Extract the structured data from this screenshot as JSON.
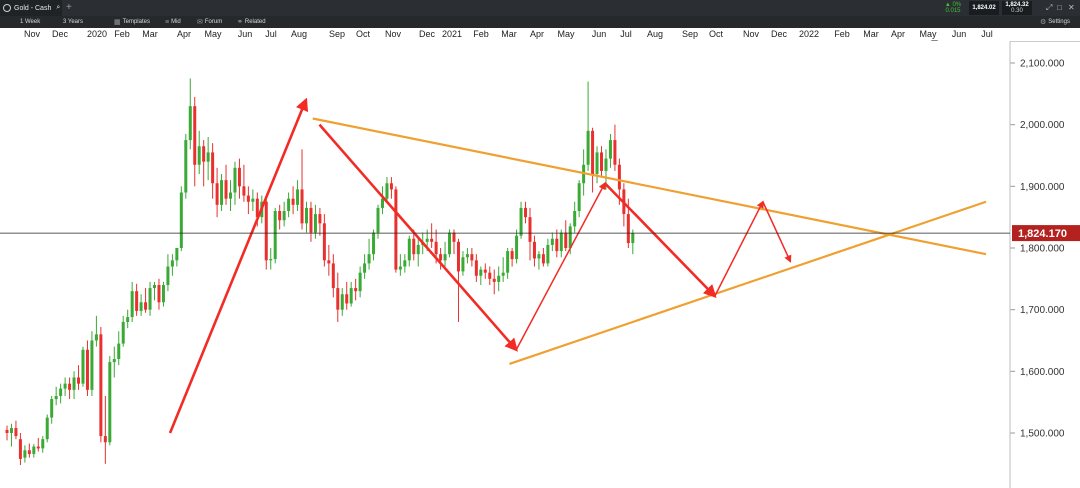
{
  "app": {
    "tab_title": "Gold - Cash",
    "new_tab_symbol": "+",
    "change_pct": "▲ 0%",
    "change_abs": "0.015",
    "bid": "1,824.02",
    "ask": "1,824.32",
    "spread": "0.30",
    "window_buttons": [
      "⤢",
      "□",
      "✕"
    ]
  },
  "toolbar": {
    "interval": "1 Week",
    "range": "3 Years",
    "templates": "Templates",
    "mid": "Mid",
    "forum": "Forum",
    "related": "Related",
    "settings": "Settings"
  },
  "timeline": {
    "months": [
      "Nov",
      "Dec",
      "2020",
      "Feb",
      "Mar",
      "Apr",
      "May",
      "Jun",
      "Jul",
      "Aug",
      "Sep",
      "Oct",
      "Nov",
      "Dec",
      "2021",
      "Feb",
      "Mar",
      "Apr",
      "May",
      "Jun",
      "Jul",
      "Aug",
      "Sep",
      "Oct",
      "Nov",
      "Dec",
      "2022",
      "Feb",
      "Mar",
      "Apr",
      "May",
      "Jun",
      "Jul"
    ]
  },
  "colors": {
    "up": "#3aa935",
    "down": "#e8302f",
    "trendline": "#f0a030",
    "arrow": "#f22b25",
    "price_tag": "#b3221e",
    "grid": "#e5e5e5"
  },
  "chart_data": {
    "type": "candlestick",
    "instrument": "Gold - Cash",
    "interval": "1 Week",
    "current_price": "1,824.170",
    "y_ticks": [
      "2,100.000",
      "2,000.000",
      "1,900.000",
      "1,800.000",
      "1,700.000",
      "1,600.000",
      "1,500.000"
    ],
    "ylim": [
      1430,
      2130
    ],
    "trendlines": [
      {
        "from": [
          "2020-08-10",
          2010
        ],
        "to": [
          "2022-06-30",
          1790
        ]
      },
      {
        "from": [
          "2021-03-01",
          1612
        ],
        "to": [
          "2022-06-30",
          1875
        ]
      }
    ],
    "arrows": [
      {
        "from": [
          "2020-03-16",
          1500
        ],
        "to": [
          "2020-08-03",
          2040
        ]
      },
      {
        "from": [
          "2020-08-17",
          2000
        ],
        "to": [
          "2021-03-08",
          1635
        ]
      },
      {
        "from": [
          "2021-03-08",
          1635
        ],
        "to": [
          "2021-06-07",
          1905
        ]
      },
      {
        "from": [
          "2021-06-07",
          1905
        ],
        "to": [
          "2021-09-27",
          1722
        ]
      },
      {
        "from": [
          "2021-09-27",
          1722
        ],
        "to": [
          "2021-11-15",
          1875
        ]
      },
      {
        "from": [
          "2021-11-15",
          1875
        ],
        "to": [
          "2021-12-13",
          1778
        ]
      }
    ],
    "candles": [
      {
        "o": 1505,
        "h": 1512,
        "l": 1488,
        "c": 1500
      },
      {
        "o": 1500,
        "h": 1515,
        "l": 1478,
        "c": 1508
      },
      {
        "o": 1508,
        "h": 1520,
        "l": 1490,
        "c": 1495
      },
      {
        "o": 1490,
        "h": 1500,
        "l": 1448,
        "c": 1458
      },
      {
        "o": 1460,
        "h": 1480,
        "l": 1452,
        "c": 1472
      },
      {
        "o": 1472,
        "h": 1483,
        "l": 1460,
        "c": 1466
      },
      {
        "o": 1466,
        "h": 1482,
        "l": 1460,
        "c": 1478
      },
      {
        "o": 1478,
        "h": 1492,
        "l": 1470,
        "c": 1475
      },
      {
        "o": 1475,
        "h": 1495,
        "l": 1468,
        "c": 1490
      },
      {
        "o": 1490,
        "h": 1530,
        "l": 1485,
        "c": 1525
      },
      {
        "o": 1525,
        "h": 1560,
        "l": 1515,
        "c": 1555
      },
      {
        "o": 1555,
        "h": 1575,
        "l": 1545,
        "c": 1560
      },
      {
        "o": 1560,
        "h": 1580,
        "l": 1548,
        "c": 1572
      },
      {
        "o": 1572,
        "h": 1590,
        "l": 1560,
        "c": 1580
      },
      {
        "o": 1580,
        "h": 1590,
        "l": 1555,
        "c": 1570
      },
      {
        "o": 1570,
        "h": 1600,
        "l": 1555,
        "c": 1590
      },
      {
        "o": 1590,
        "h": 1610,
        "l": 1570,
        "c": 1580
      },
      {
        "o": 1580,
        "h": 1640,
        "l": 1575,
        "c": 1635
      },
      {
        "o": 1635,
        "h": 1650,
        "l": 1560,
        "c": 1570
      },
      {
        "o": 1570,
        "h": 1665,
        "l": 1560,
        "c": 1650
      },
      {
        "o": 1650,
        "h": 1690,
        "l": 1640,
        "c": 1660
      },
      {
        "o": 1660,
        "h": 1672,
        "l": 1485,
        "c": 1495
      },
      {
        "o": 1495,
        "h": 1560,
        "l": 1450,
        "c": 1485
      },
      {
        "o": 1485,
        "h": 1625,
        "l": 1480,
        "c": 1615
      },
      {
        "o": 1615,
        "h": 1640,
        "l": 1590,
        "c": 1620
      },
      {
        "o": 1620,
        "h": 1665,
        "l": 1610,
        "c": 1645
      },
      {
        "o": 1645,
        "h": 1690,
        "l": 1640,
        "c": 1680
      },
      {
        "o": 1680,
        "h": 1700,
        "l": 1670,
        "c": 1688
      },
      {
        "o": 1688,
        "h": 1745,
        "l": 1680,
        "c": 1730
      },
      {
        "o": 1730,
        "h": 1742,
        "l": 1690,
        "c": 1698
      },
      {
        "o": 1698,
        "h": 1725,
        "l": 1690,
        "c": 1712
      },
      {
        "o": 1712,
        "h": 1735,
        "l": 1695,
        "c": 1700
      },
      {
        "o": 1700,
        "h": 1745,
        "l": 1690,
        "c": 1735
      },
      {
        "o": 1735,
        "h": 1745,
        "l": 1715,
        "c": 1740
      },
      {
        "o": 1740,
        "h": 1750,
        "l": 1700,
        "c": 1712
      },
      {
        "o": 1712,
        "h": 1745,
        "l": 1705,
        "c": 1740
      },
      {
        "o": 1740,
        "h": 1790,
        "l": 1730,
        "c": 1770
      },
      {
        "o": 1770,
        "h": 1790,
        "l": 1755,
        "c": 1780
      },
      {
        "o": 1780,
        "h": 1800,
        "l": 1770,
        "c": 1800
      },
      {
        "o": 1800,
        "h": 1900,
        "l": 1795,
        "c": 1890
      },
      {
        "o": 1890,
        "h": 1985,
        "l": 1880,
        "c": 1975
      },
      {
        "o": 1975,
        "h": 2075,
        "l": 1960,
        "c": 2030
      },
      {
        "o": 2030,
        "h": 2045,
        "l": 1900,
        "c": 1935
      },
      {
        "o": 1935,
        "h": 1990,
        "l": 1920,
        "c": 1965
      },
      {
        "o": 1965,
        "h": 1975,
        "l": 1900,
        "c": 1940
      },
      {
        "o": 1940,
        "h": 1980,
        "l": 1910,
        "c": 1955
      },
      {
        "o": 1955,
        "h": 1970,
        "l": 1880,
        "c": 1905
      },
      {
        "o": 1905,
        "h": 1930,
        "l": 1850,
        "c": 1870
      },
      {
        "o": 1870,
        "h": 1920,
        "l": 1860,
        "c": 1910
      },
      {
        "o": 1910,
        "h": 1935,
        "l": 1870,
        "c": 1880
      },
      {
        "o": 1880,
        "h": 1910,
        "l": 1860,
        "c": 1890
      },
      {
        "o": 1890,
        "h": 1940,
        "l": 1870,
        "c": 1930
      },
      {
        "o": 1930,
        "h": 1945,
        "l": 1880,
        "c": 1900
      },
      {
        "o": 1900,
        "h": 1935,
        "l": 1875,
        "c": 1885
      },
      {
        "o": 1885,
        "h": 1900,
        "l": 1855,
        "c": 1875
      },
      {
        "o": 1875,
        "h": 1895,
        "l": 1860,
        "c": 1880
      },
      {
        "o": 1880,
        "h": 1890,
        "l": 1835,
        "c": 1850
      },
      {
        "o": 1850,
        "h": 1885,
        "l": 1840,
        "c": 1875
      },
      {
        "o": 1875,
        "h": 1880,
        "l": 1765,
        "c": 1780
      },
      {
        "o": 1780,
        "h": 1800,
        "l": 1765,
        "c": 1782
      },
      {
        "o": 1782,
        "h": 1865,
        "l": 1775,
        "c": 1860
      },
      {
        "o": 1860,
        "h": 1870,
        "l": 1830,
        "c": 1845
      },
      {
        "o": 1845,
        "h": 1875,
        "l": 1835,
        "c": 1860
      },
      {
        "o": 1860,
        "h": 1890,
        "l": 1850,
        "c": 1880
      },
      {
        "o": 1880,
        "h": 1900,
        "l": 1855,
        "c": 1870
      },
      {
        "o": 1870,
        "h": 1910,
        "l": 1860,
        "c": 1895
      },
      {
        "o": 1895,
        "h": 1960,
        "l": 1830,
        "c": 1840
      },
      {
        "o": 1840,
        "h": 1875,
        "l": 1825,
        "c": 1865
      },
      {
        "o": 1865,
        "h": 1875,
        "l": 1810,
        "c": 1825
      },
      {
        "o": 1825,
        "h": 1870,
        "l": 1815,
        "c": 1855
      },
      {
        "o": 1855,
        "h": 1865,
        "l": 1820,
        "c": 1840
      },
      {
        "o": 1840,
        "h": 1855,
        "l": 1770,
        "c": 1780
      },
      {
        "o": 1780,
        "h": 1805,
        "l": 1755,
        "c": 1775
      },
      {
        "o": 1775,
        "h": 1790,
        "l": 1720,
        "c": 1735
      },
      {
        "o": 1735,
        "h": 1760,
        "l": 1680,
        "c": 1700
      },
      {
        "o": 1700,
        "h": 1735,
        "l": 1690,
        "c": 1725
      },
      {
        "o": 1725,
        "h": 1745,
        "l": 1700,
        "c": 1710
      },
      {
        "o": 1710,
        "h": 1745,
        "l": 1705,
        "c": 1735
      },
      {
        "o": 1735,
        "h": 1750,
        "l": 1715,
        "c": 1730
      },
      {
        "o": 1730,
        "h": 1770,
        "l": 1720,
        "c": 1760
      },
      {
        "o": 1760,
        "h": 1790,
        "l": 1750,
        "c": 1775
      },
      {
        "o": 1775,
        "h": 1815,
        "l": 1765,
        "c": 1790
      },
      {
        "o": 1790,
        "h": 1830,
        "l": 1780,
        "c": 1825
      },
      {
        "o": 1825,
        "h": 1870,
        "l": 1815,
        "c": 1865
      },
      {
        "o": 1865,
        "h": 1900,
        "l": 1855,
        "c": 1880
      },
      {
        "o": 1880,
        "h": 1915,
        "l": 1875,
        "c": 1905
      },
      {
        "o": 1905,
        "h": 1915,
        "l": 1880,
        "c": 1895
      },
      {
        "o": 1895,
        "h": 1900,
        "l": 1760,
        "c": 1765
      },
      {
        "o": 1765,
        "h": 1790,
        "l": 1755,
        "c": 1770
      },
      {
        "o": 1770,
        "h": 1790,
        "l": 1760,
        "c": 1780
      },
      {
        "o": 1780,
        "h": 1820,
        "l": 1770,
        "c": 1815
      },
      {
        "o": 1815,
        "h": 1830,
        "l": 1780,
        "c": 1790
      },
      {
        "o": 1790,
        "h": 1815,
        "l": 1770,
        "c": 1805
      },
      {
        "o": 1805,
        "h": 1825,
        "l": 1790,
        "c": 1810
      },
      {
        "o": 1810,
        "h": 1830,
        "l": 1795,
        "c": 1815
      },
      {
        "o": 1815,
        "h": 1840,
        "l": 1800,
        "c": 1810
      },
      {
        "o": 1810,
        "h": 1830,
        "l": 1775,
        "c": 1790
      },
      {
        "o": 1790,
        "h": 1800,
        "l": 1765,
        "c": 1780
      },
      {
        "o": 1780,
        "h": 1810,
        "l": 1770,
        "c": 1790
      },
      {
        "o": 1790,
        "h": 1830,
        "l": 1785,
        "c": 1825
      },
      {
        "o": 1825,
        "h": 1830,
        "l": 1790,
        "c": 1810
      },
      {
        "o": 1810,
        "h": 1815,
        "l": 1680,
        "c": 1762
      },
      {
        "o": 1762,
        "h": 1795,
        "l": 1755,
        "c": 1785
      },
      {
        "o": 1785,
        "h": 1800,
        "l": 1775,
        "c": 1790
      },
      {
        "o": 1790,
        "h": 1800,
        "l": 1770,
        "c": 1780
      },
      {
        "o": 1780,
        "h": 1790,
        "l": 1745,
        "c": 1755
      },
      {
        "o": 1755,
        "h": 1770,
        "l": 1740,
        "c": 1765
      },
      {
        "o": 1765,
        "h": 1775,
        "l": 1750,
        "c": 1760
      },
      {
        "o": 1760,
        "h": 1770,
        "l": 1740,
        "c": 1750
      },
      {
        "o": 1750,
        "h": 1765,
        "l": 1725,
        "c": 1745
      },
      {
        "o": 1745,
        "h": 1770,
        "l": 1730,
        "c": 1755
      },
      {
        "o": 1755,
        "h": 1785,
        "l": 1745,
        "c": 1760
      },
      {
        "o": 1760,
        "h": 1800,
        "l": 1750,
        "c": 1795
      },
      {
        "o": 1795,
        "h": 1800,
        "l": 1770,
        "c": 1782
      },
      {
        "o": 1782,
        "h": 1830,
        "l": 1775,
        "c": 1820
      },
      {
        "o": 1820,
        "h": 1875,
        "l": 1815,
        "c": 1865
      },
      {
        "o": 1865,
        "h": 1875,
        "l": 1840,
        "c": 1850
      },
      {
        "o": 1850,
        "h": 1865,
        "l": 1780,
        "c": 1810
      },
      {
        "o": 1810,
        "h": 1820,
        "l": 1770,
        "c": 1783
      },
      {
        "o": 1783,
        "h": 1795,
        "l": 1765,
        "c": 1790
      },
      {
        "o": 1790,
        "h": 1800,
        "l": 1770,
        "c": 1775
      },
      {
        "o": 1775,
        "h": 1815,
        "l": 1770,
        "c": 1805
      },
      {
        "o": 1805,
        "h": 1825,
        "l": 1795,
        "c": 1815
      },
      {
        "o": 1815,
        "h": 1830,
        "l": 1785,
        "c": 1795
      },
      {
        "o": 1795,
        "h": 1830,
        "l": 1785,
        "c": 1825
      },
      {
        "o": 1825,
        "h": 1845,
        "l": 1795,
        "c": 1800
      },
      {
        "o": 1800,
        "h": 1840,
        "l": 1790,
        "c": 1835
      },
      {
        "o": 1835,
        "h": 1875,
        "l": 1825,
        "c": 1860
      },
      {
        "o": 1860,
        "h": 1910,
        "l": 1850,
        "c": 1905
      },
      {
        "o": 1905,
        "h": 1960,
        "l": 1885,
        "c": 1935
      },
      {
        "o": 1935,
        "h": 2070,
        "l": 1925,
        "c": 1990
      },
      {
        "o": 1990,
        "h": 1995,
        "l": 1890,
        "c": 1920
      },
      {
        "o": 1920,
        "h": 1965,
        "l": 1905,
        "c": 1955
      },
      {
        "o": 1955,
        "h": 1965,
        "l": 1915,
        "c": 1925
      },
      {
        "o": 1925,
        "h": 1960,
        "l": 1895,
        "c": 1945
      },
      {
        "o": 1945,
        "h": 1985,
        "l": 1930,
        "c": 1975
      },
      {
        "o": 1975,
        "h": 2000,
        "l": 1925,
        "c": 1935
      },
      {
        "o": 1935,
        "h": 1945,
        "l": 1870,
        "c": 1895
      },
      {
        "o": 1895,
        "h": 1905,
        "l": 1835,
        "c": 1855
      },
      {
        "o": 1855,
        "h": 1880,
        "l": 1800,
        "c": 1808
      },
      {
        "o": 1808,
        "h": 1830,
        "l": 1790,
        "c": 1824
      }
    ]
  }
}
